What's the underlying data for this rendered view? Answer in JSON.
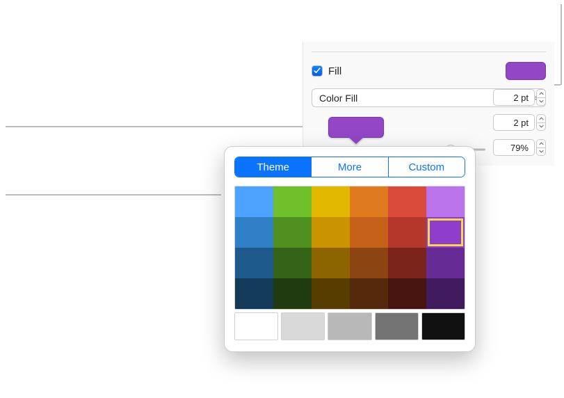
{
  "fill": {
    "checkbox_checked": true,
    "label": "Fill",
    "swatch_color": "#9346c6"
  },
  "fill_type": {
    "selected": "Color Fill"
  },
  "color_well": {
    "color": "#9346c6"
  },
  "popover": {
    "tabs": [
      "Theme",
      "More",
      "Custom"
    ],
    "active_tab_index": 0,
    "grid_rows": [
      [
        "#4da3ff",
        "#6fbf2a",
        "#e3b800",
        "#e07a1f",
        "#d94a3a",
        "#bb73ea"
      ],
      [
        "#2f80c7",
        "#4f9020",
        "#c99400",
        "#c6611a",
        "#b5362b",
        "#8e3ecb"
      ],
      [
        "#1f5a8c",
        "#356318",
        "#8c6400",
        "#8c4412",
        "#7a231b",
        "#662b95"
      ],
      [
        "#143a59",
        "#203b0f",
        "#573d00",
        "#55290b",
        "#471410",
        "#3f1a5c"
      ]
    ],
    "selected_row": 1,
    "selected_col": 5,
    "neutral_row": [
      "#ffffff",
      "#d9d9d9",
      "#b8b8b8",
      "#737373",
      "#111111"
    ]
  },
  "steppers": [
    {
      "value": "2 pt"
    },
    {
      "value": "2 pt"
    },
    {
      "value": "79%"
    }
  ],
  "slider": {
    "value_percent": 79
  }
}
